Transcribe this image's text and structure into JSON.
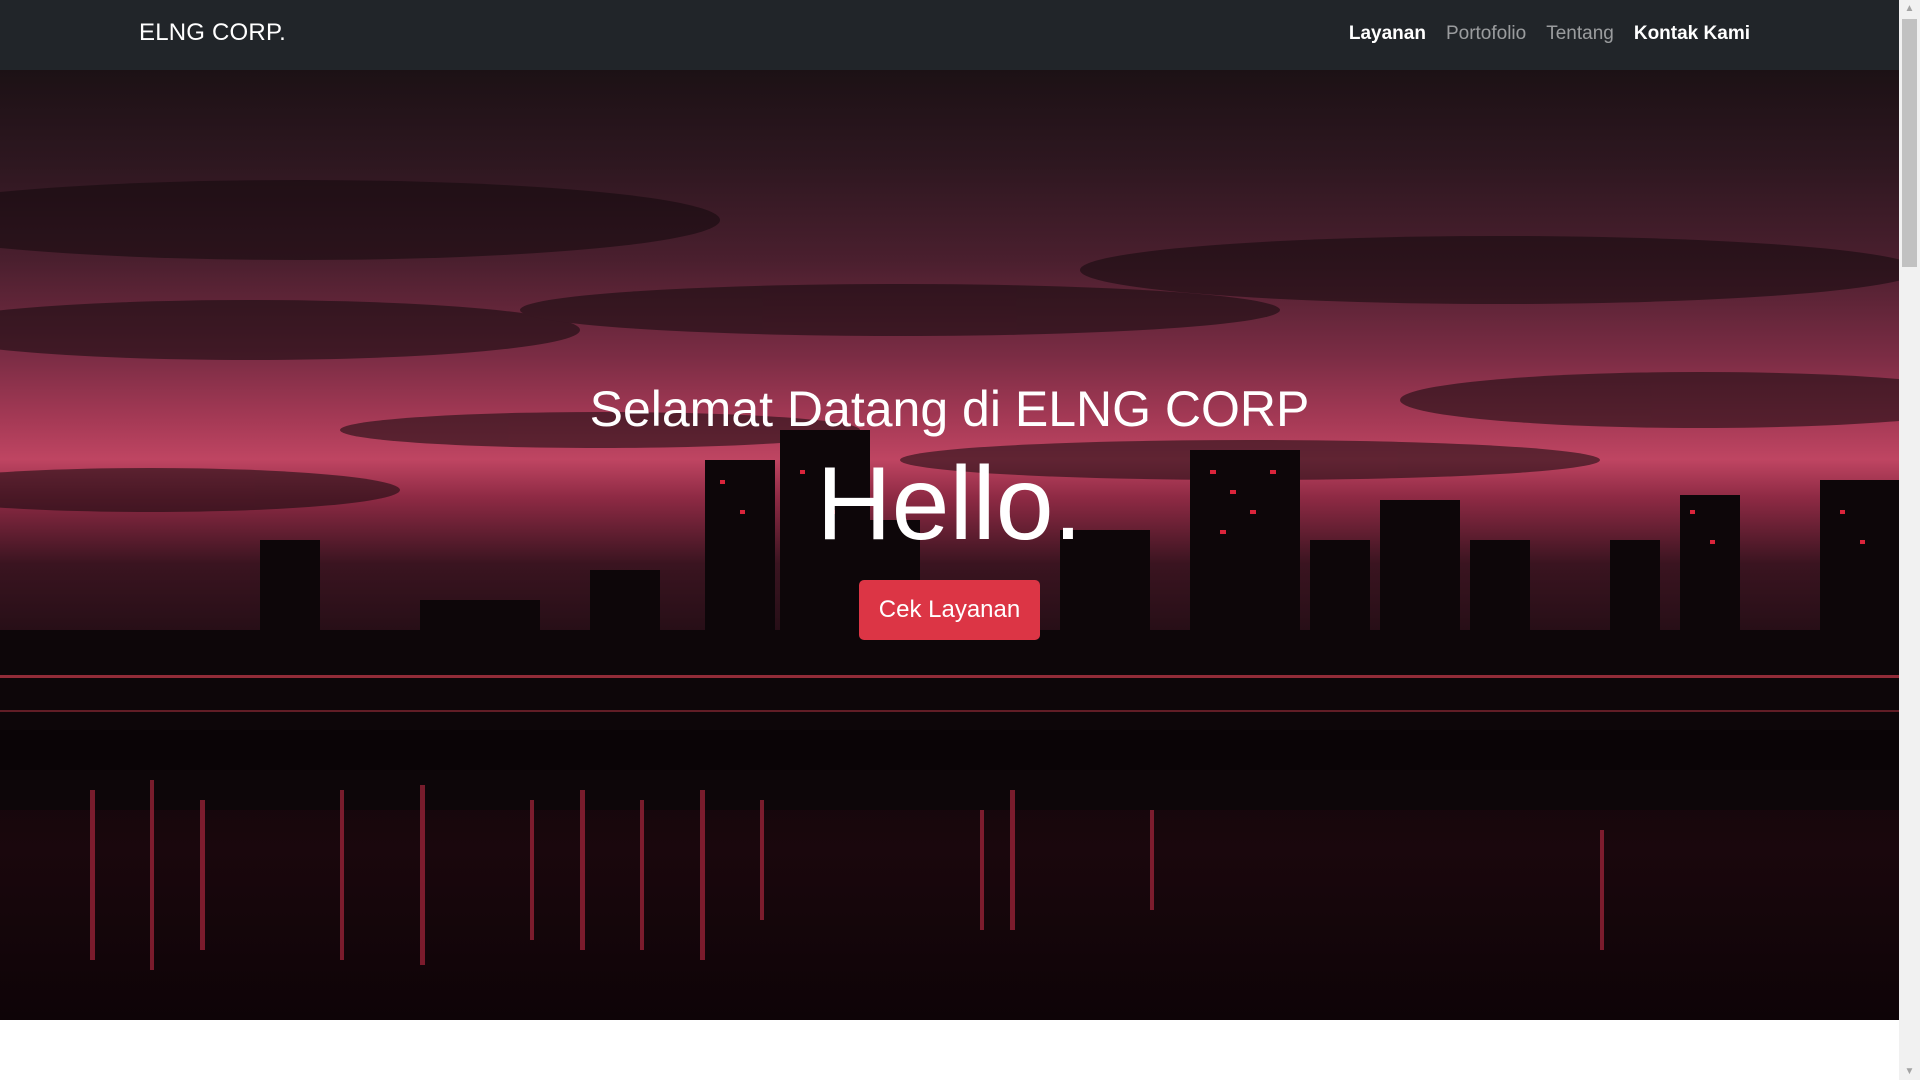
{
  "navbar": {
    "brand": "ELNG CORP.",
    "links": [
      {
        "label": "Layanan",
        "state": "active"
      },
      {
        "label": "Portofolio",
        "state": "muted"
      },
      {
        "label": "Tentang",
        "state": "muted"
      },
      {
        "label": "Kontak Kami",
        "state": "active"
      }
    ]
  },
  "hero": {
    "subtitle": "Selamat Datang di ELNG CORP",
    "headline": "Hello.",
    "cta_label": "Cek Layanan",
    "background_image": "night-city-skyline-red-sky",
    "accent_color": "#dc3545"
  },
  "scrollbar": {
    "up_icon": "triangle-up-icon",
    "down_icon": "triangle-down-icon"
  }
}
